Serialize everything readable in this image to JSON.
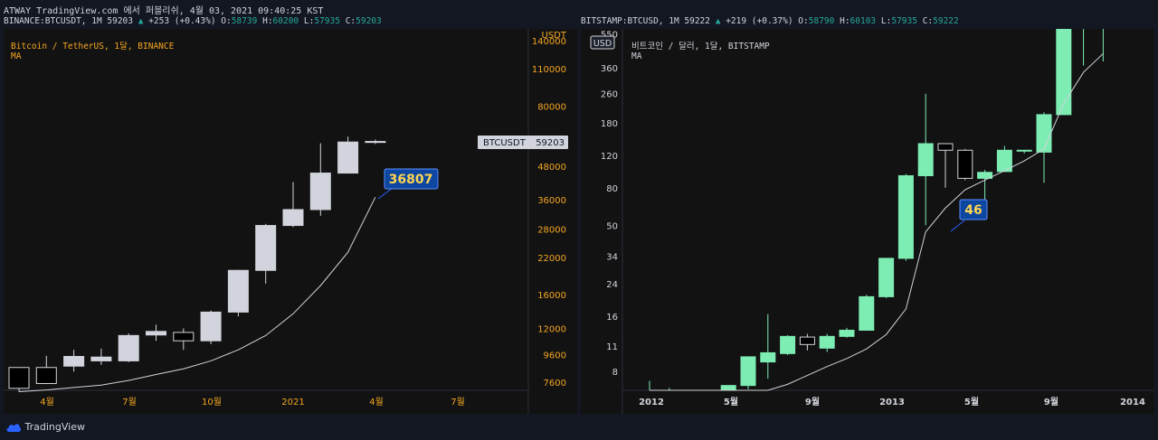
{
  "header": {
    "top_line": "ATWAY TradingView.com 에서 퍼블리쉬, 4월 03, 2021 09:40:25 KST"
  },
  "left": {
    "symbol_line": {
      "ticker": "BINANCE:BTCUSDT, 1M 59203",
      "arrow": "▲",
      "change": "+253 (+0.43%)",
      "o_label": "O:",
      "o": "58739",
      "h_label": "H:",
      "h": "60200",
      "l_label": "L:",
      "l": "57935",
      "c_label": "C:",
      "c": "59203"
    },
    "legend_title": "Bitcoin / TetherUS, 1달, BINANCE",
    "legend_ma": "MA",
    "price_tag_label": "BTCUSDT",
    "price_tag_value": "59203",
    "ma_tag_value": "36807",
    "currency_label": "USDT"
  },
  "right": {
    "symbol_line": {
      "ticker": "BITSTAMP:BTCUSD, 1M 59222",
      "arrow": "▲",
      "change": "+219 (+0.37%)",
      "o_label": "O:",
      "o": "58790",
      "h_label": "H:",
      "h": "60103",
      "l_label": "L:",
      "l": "57935",
      "c_label": "C:",
      "c": "59222"
    },
    "currency_badge": "USD",
    "legend_title": "비트코인 / 달러, 1달, BITSTAMP",
    "legend_ma": "MA",
    "ma_tag_value": "46"
  },
  "footer": {
    "brand": "TradingView"
  },
  "colors": {
    "bg": "#131722",
    "pane": "#121212",
    "axis_text_left": "#f5a623",
    "axis_text_right": "#d1d4dc",
    "up_left": "#d1d4dc",
    "down_left": "#000000",
    "up_right": "#7dedb4",
    "ma_line": "#d1d4dc",
    "tag_blue": "#0d47a1",
    "tag_text": "#ffd54f"
  },
  "chart_data": [
    {
      "type": "candlestick",
      "title": "Bitcoin / TetherUS, 1달, BINANCE",
      "scale": "log",
      "ylim": [
        7300,
        150000
      ],
      "y_ticks": [
        "7600",
        "9600",
        "12000",
        "16000",
        "22000",
        "28000",
        "36000",
        "48000",
        "80000",
        "110000",
        "140000"
      ],
      "x_ticks": [
        "4월",
        "7월",
        "10월",
        "2021",
        "4월",
        "7월"
      ],
      "candles": [
        {
          "o": 7200,
          "h": 8050,
          "l": 7000,
          "c": 8600,
          "dir": "down"
        },
        {
          "o": 8600,
          "h": 9500,
          "l": 8300,
          "c": 7500,
          "dir": "down"
        },
        {
          "o": 8700,
          "h": 10000,
          "l": 8300,
          "c": 9450
        },
        {
          "o": 9100,
          "h": 10100,
          "l": 8800,
          "c": 9400
        },
        {
          "o": 9100,
          "h": 11500,
          "l": 9000,
          "c": 11300
        },
        {
          "o": 11350,
          "h": 12400,
          "l": 10800,
          "c": 11700
        },
        {
          "o": 11600,
          "h": 12000,
          "l": 10000,
          "c": 10800,
          "dir": "down"
        },
        {
          "o": 10800,
          "h": 14000,
          "l": 10500,
          "c": 13800
        },
        {
          "o": 13800,
          "h": 19800,
          "l": 13300,
          "c": 19700
        },
        {
          "o": 19700,
          "h": 29300,
          "l": 17600,
          "c": 28900
        },
        {
          "o": 28900,
          "h": 41900,
          "l": 28500,
          "c": 33100
        },
        {
          "o": 33100,
          "h": 58300,
          "l": 31400,
          "c": 45200
        },
        {
          "o": 45200,
          "h": 61700,
          "l": 45000,
          "c": 58900
        },
        {
          "o": 58700,
          "h": 60200,
          "l": 57900,
          "c": 59200
        }
      ],
      "ma": [
        7000,
        7100,
        7250,
        7400,
        7700,
        8100,
        8500,
        9100,
        10000,
        11300,
        13600,
        17300,
        23000,
        36807
      ],
      "last_price": 59203
    },
    {
      "type": "candlestick",
      "title": "비트코인 / 달러, 1달, BITSTAMP",
      "scale": "log",
      "ylim": [
        6.6,
        560
      ],
      "y_ticks": [
        "8",
        "11",
        "16",
        "24",
        "34",
        "50",
        "80",
        "120",
        "180",
        "260",
        "360",
        "550"
      ],
      "x_ticks": [
        "2012",
        "5월",
        "9월",
        "2013",
        "5월",
        "9월",
        "2014"
      ],
      "candles": [
        {
          "o": 4.6,
          "h": 7.1,
          "l": 4.4,
          "c": 4.9
        },
        {
          "o": 4.9,
          "h": 6.5,
          "l": 4.6,
          "c": 4.8
        },
        {
          "o": 4.8,
          "h": 5.4,
          "l": 4.4,
          "c": 5.0
        },
        {
          "o": 5.0,
          "h": 5.8,
          "l": 4.8,
          "c": 5.4
        },
        {
          "o": 5.1,
          "h": 5.6,
          "l": 4.9,
          "c": 6.7
        },
        {
          "o": 6.7,
          "h": 6.8,
          "l": 6.4,
          "c": 9.6
        },
        {
          "o": 9.0,
          "h": 16.4,
          "l": 7.3,
          "c": 10.1
        },
        {
          "o": 10.0,
          "h": 12.6,
          "l": 9.8,
          "c": 12.4
        },
        {
          "o": 12.3,
          "h": 12.8,
          "l": 10.4,
          "c": 11.2,
          "dir": "down"
        },
        {
          "o": 10.7,
          "h": 12.8,
          "l": 10.2,
          "c": 12.4
        },
        {
          "o": 12.4,
          "h": 13.8,
          "l": 12.2,
          "c": 13.4
        },
        {
          "o": 13.4,
          "h": 20.9,
          "l": 13.3,
          "c": 20.4
        },
        {
          "o": 20.4,
          "h": 33.0,
          "l": 20.0,
          "c": 33.0
        },
        {
          "o": 33.0,
          "h": 95.0,
          "l": 32.0,
          "c": 93.0
        },
        {
          "o": 93.0,
          "h": 260.0,
          "l": 50.0,
          "c": 139.0
        },
        {
          "o": 139.0,
          "h": 139.0,
          "l": 80.0,
          "c": 128.0,
          "dir": "down"
        },
        {
          "o": 128.0,
          "h": 130.0,
          "l": 88.0,
          "c": 90.0,
          "dir": "down"
        },
        {
          "o": 90.0,
          "h": 100.0,
          "l": 64.0,
          "c": 97.0
        },
        {
          "o": 98.0,
          "h": 135.0,
          "l": 98.0,
          "c": 128.0
        },
        {
          "o": 128.0,
          "h": 127.0,
          "l": 123.0,
          "c": 127.0
        },
        {
          "o": 125.0,
          "h": 206.0,
          "l": 85.0,
          "c": 200.0
        },
        {
          "o": 200.0,
          "h": 1163.0,
          "l": 200.0,
          "c": 1000.0
        },
        {
          "o": 1000.0,
          "h": 1100.0,
          "l": 370.0,
          "c": 740.0
        },
        {
          "o": 740.0,
          "h": 980.0,
          "l": 390.0,
          "c": 800.0
        }
      ],
      "ma": [
        4.2,
        4.4,
        4.6,
        4.8,
        5.0,
        5.4,
        6.0,
        6.8,
        7.6,
        8.5,
        9.4,
        10.6,
        12.7,
        17.5,
        46,
        62,
        78,
        88,
        99,
        112,
        130,
        230,
        340,
        430
      ],
      "x_start": 700,
      "x_step": 21.7
    }
  ]
}
